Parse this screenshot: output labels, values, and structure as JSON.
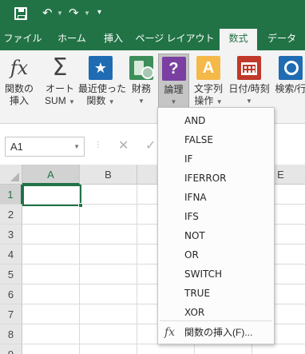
{
  "quick_access": {
    "save_icon": "save-icon",
    "undo_icon": "undo-icon",
    "redo_icon": "redo-icon",
    "more_glyph": "▾"
  },
  "tabs": [
    {
      "label": "ファイル",
      "active": false
    },
    {
      "label": "ホーム",
      "active": false
    },
    {
      "label": "挿入",
      "active": false
    },
    {
      "label": "ページ レイアウト",
      "active": false
    },
    {
      "label": "数式",
      "active": true
    },
    {
      "label": "データ",
      "active": false
    }
  ],
  "ribbon": {
    "insert_function": {
      "line1": "関数の",
      "line2": "挿入",
      "icon": "fx-icon"
    },
    "autosum": {
      "line1": "オート",
      "line2": "SUM",
      "icon": "sigma-icon"
    },
    "recent": {
      "line1": "最近使った",
      "line2": "関数",
      "icon": "star-icon"
    },
    "financial": {
      "line1": "財務",
      "line2": "",
      "icon": "financial-icon"
    },
    "logical": {
      "line1": "論理",
      "line2": "",
      "icon": "logical-icon",
      "icon_text": "?"
    },
    "text": {
      "line1": "文字列",
      "line2": "操作",
      "icon": "text-icon",
      "icon_text": "A"
    },
    "datetime": {
      "line1": "日付/時刻",
      "line2": "",
      "icon": "calendar-icon"
    },
    "lookup": {
      "line1": "検索/行",
      "line2": "",
      "icon": "lookup-icon"
    }
  },
  "formula_bar": {
    "name_box": "A1",
    "cancel_glyph": "✕",
    "enter_glyph": "✓"
  },
  "grid": {
    "columns": [
      "A",
      "B",
      "",
      "",
      "E"
    ],
    "rows": [
      "1",
      "2",
      "3",
      "4",
      "5",
      "6",
      "7",
      "8",
      "9"
    ],
    "selected_cell": "A1"
  },
  "logical_menu": {
    "items": [
      "AND",
      "FALSE",
      "IF",
      "IFERROR",
      "IFNA",
      "IFS",
      "NOT",
      "OR",
      "SWITCH",
      "TRUE",
      "XOR"
    ],
    "insert_function": "関数の挿入(F)..."
  },
  "colors": {
    "accent": "#217346",
    "ribbon_bg": "#f3f3f3",
    "header_bg": "#e6e6e6"
  }
}
